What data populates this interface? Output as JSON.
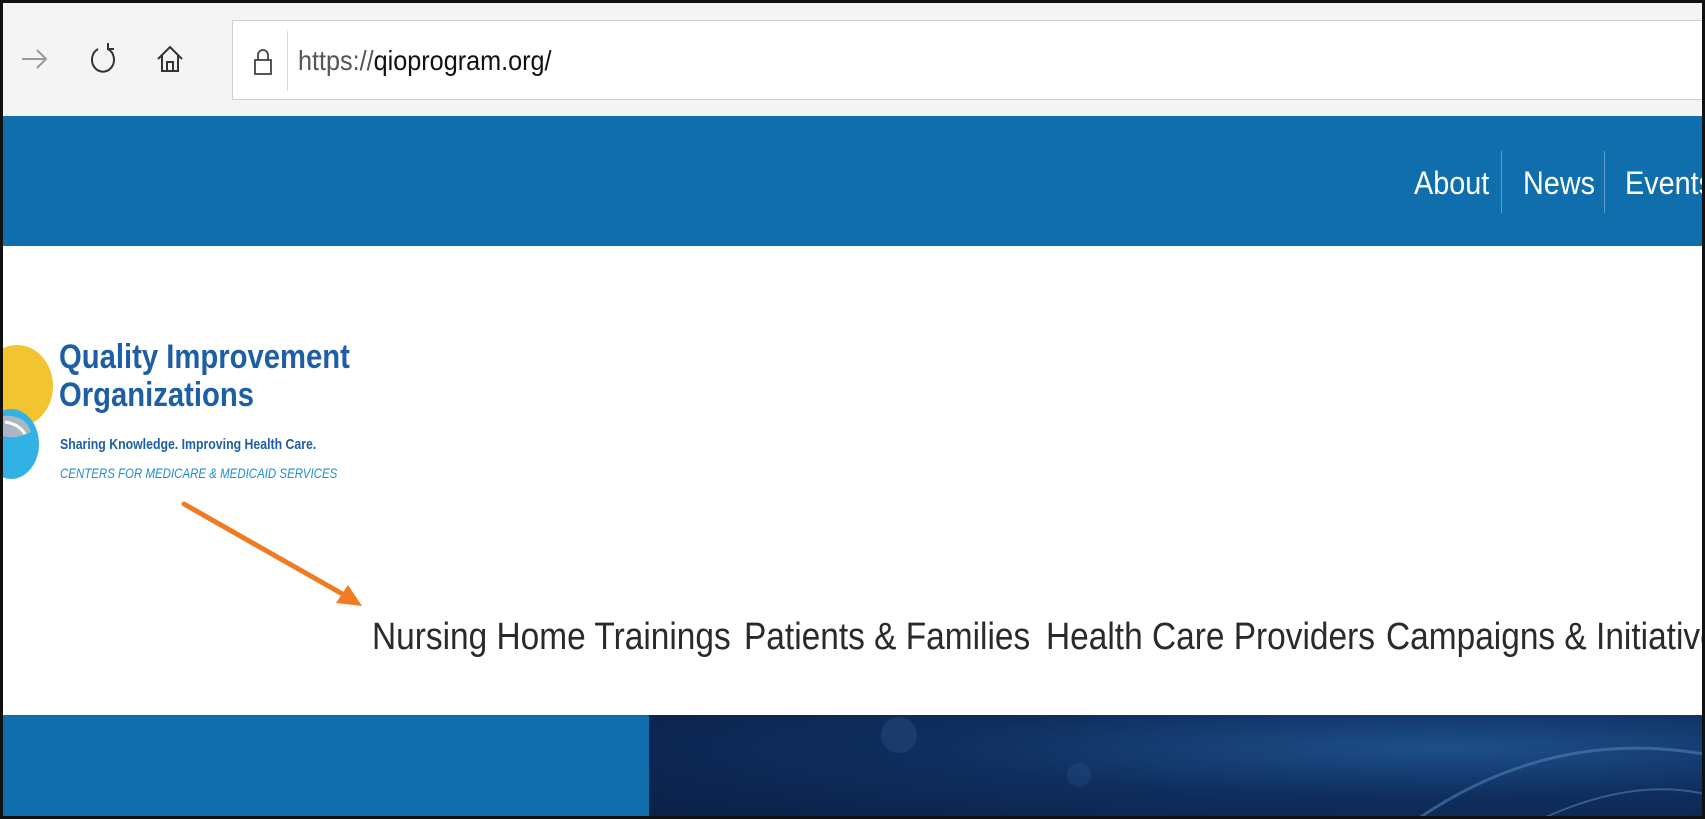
{
  "browser": {
    "url_prefix": "https://",
    "url_host": "qioprogram.org/",
    "icons": {
      "forward": "arrow-right-icon",
      "refresh": "refresh-icon",
      "home": "home-icon",
      "lock": "lock-icon"
    }
  },
  "top_nav": {
    "items": [
      {
        "label": "About"
      },
      {
        "label": "News"
      },
      {
        "label": "Events"
      }
    ]
  },
  "logo": {
    "title_line1": "Quality Improvement",
    "title_line2": "Organizations",
    "tagline": "Sharing Knowledge. Improving Health Care.",
    "subtitle": "CENTERS FOR MEDICARE & MEDICAID SERVICES"
  },
  "main_nav": {
    "items": [
      {
        "label": "Nursing Home Trainings"
      },
      {
        "label": "Patients & Families"
      },
      {
        "label": "Health Care Providers"
      },
      {
        "label": "Campaigns & Initiatives"
      }
    ]
  },
  "colors": {
    "brand_blue": "#106ead",
    "logo_blue": "#1d5ea6",
    "logo_yellow": "#f2c530",
    "arrow_orange": "#ef7b22"
  }
}
